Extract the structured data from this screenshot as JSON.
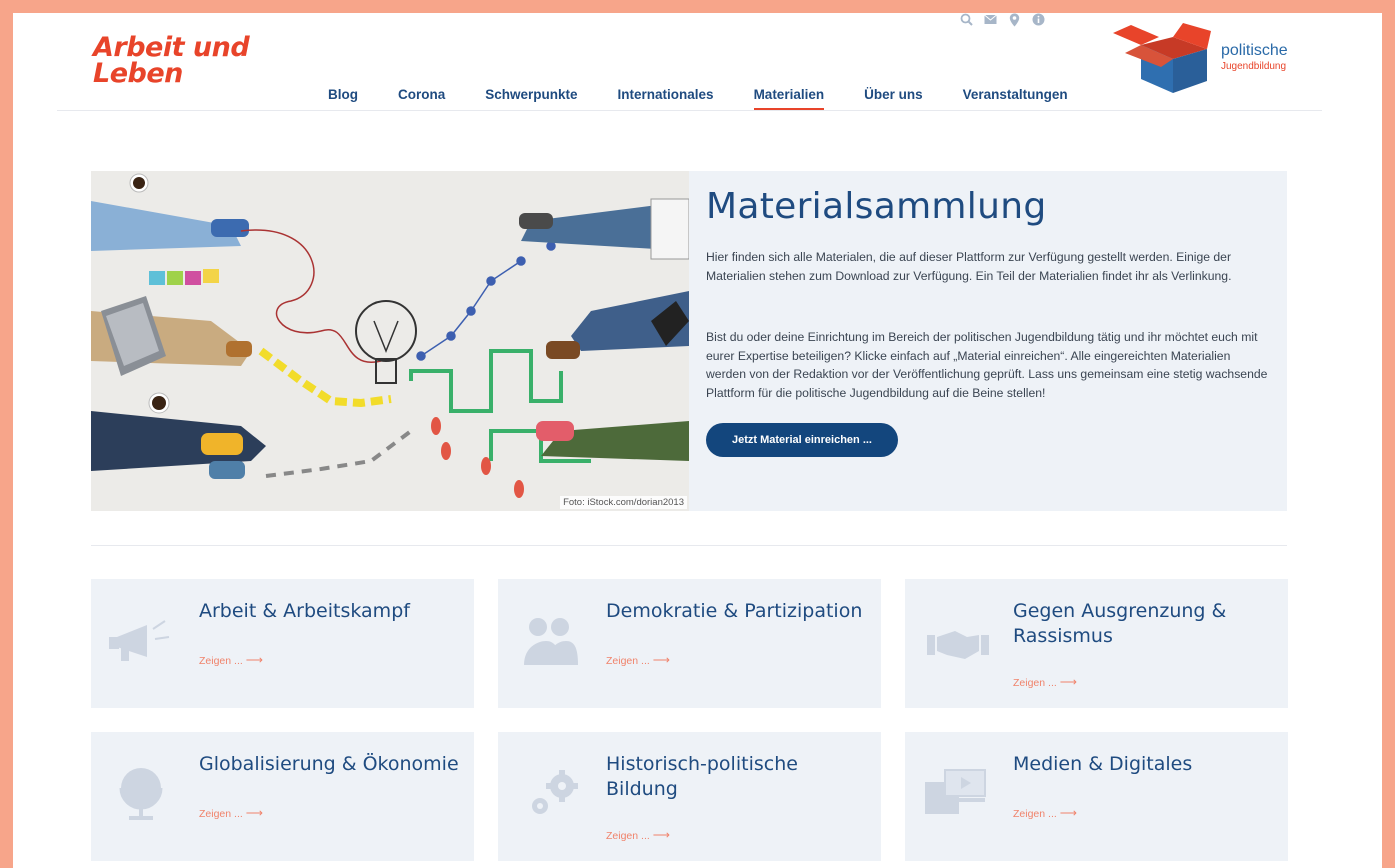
{
  "header": {
    "logo_line1": "Arbeit und",
    "logo_line2": "Leben",
    "partner_logo_line1": "politische",
    "partner_logo_line2": "Jugendbildung",
    "util_icons": [
      "search-icon",
      "mail-icon",
      "location-pin-icon",
      "info-icon"
    ]
  },
  "nav": {
    "items": [
      "Blog",
      "Corona",
      "Schwerpunkte",
      "Internationales",
      "Materialien",
      "Über uns",
      "Veranstaltungen"
    ],
    "active": "Materialien"
  },
  "hero": {
    "title": "Materialsammlung",
    "paragraph1": "Hier finden sich alle Materialen, die auf dieser Plattform zur Verfügung gestellt werden. Einige der Materialien stehen zum Download zur Verfügung. Ein Teil der Materialien findet ihr als Verlinkung.",
    "paragraph2": "Bist du oder deine Einrichtung im Bereich der politischen Jugendbildung tätig und ihr möchtet euch mit eurer Expertise beteiligen? Klicke einfach auf „Material einreichen“. Alle eingereichten Materialien werden von der Redaktion vor der Veröffentlichung geprüft. Lass uns gemeinsam eine stetig wachsende Plattform für die politische Jugendbildung auf die Beine stellen!",
    "cta_label": "Jetzt Material einreichen ...",
    "image_credit": "Foto: iStock.com/dorian2013"
  },
  "categories": [
    {
      "title": "Arbeit & Arbeitskampf",
      "link": "Zeigen ...",
      "icon": "megaphone-icon"
    },
    {
      "title": "Demokratie & Partizipation",
      "link": "Zeigen ...",
      "icon": "people-icon"
    },
    {
      "title": "Gegen Ausgrenzung & Rassismus",
      "link": "Zeigen ...",
      "icon": "handshake-icon"
    },
    {
      "title": "Globalisierung & Ökonomie",
      "link": "Zeigen ...",
      "icon": "globe-icon"
    },
    {
      "title": "Historisch-politische Bildung",
      "link": "Zeigen ...",
      "icon": "gears-icon"
    },
    {
      "title": "Medien & Digitales",
      "link": "Zeigen ...",
      "icon": "media-icon"
    }
  ],
  "colors": {
    "brand_red": "#e8442a",
    "brand_blue": "#1f4b80",
    "button_blue": "#13467d",
    "panel_bg": "#eef2f7",
    "frame_border": "#f7a58a"
  }
}
